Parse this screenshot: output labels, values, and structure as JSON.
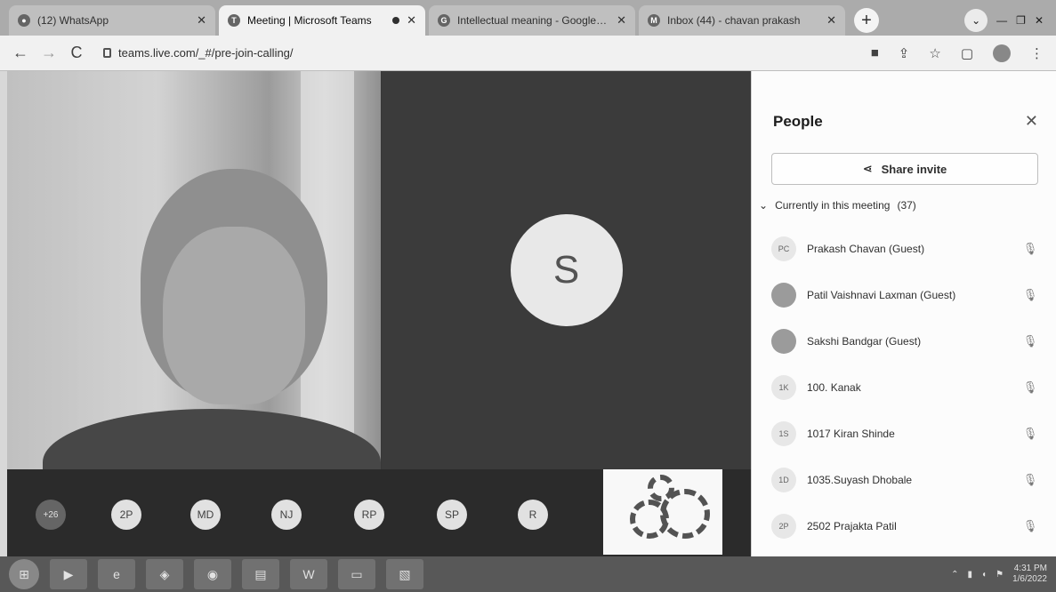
{
  "browser": {
    "tabs": [
      {
        "title": "(12) WhatsApp",
        "active": false,
        "icon": "whatsapp-icon"
      },
      {
        "title": "Meeting | Microsoft Teams",
        "active": true,
        "icon": "teams-icon"
      },
      {
        "title": "Intellectual meaning - Google Search",
        "active": false,
        "icon": "google-icon"
      },
      {
        "title": "Inbox (44) - chavan prakash",
        "active": false,
        "icon": "gmail-icon"
      }
    ],
    "new_tab": "+",
    "url": "teams.live.com/_#/pre-join-calling/"
  },
  "meeting": {
    "center_avatar": "S",
    "participants_strip": [
      {
        "initials": "+26",
        "more": true
      },
      {
        "initials": "2P"
      },
      {
        "initials": "MD"
      },
      {
        "initials": "NJ"
      },
      {
        "initials": "RP"
      },
      {
        "initials": "SP"
      },
      {
        "initials": "R"
      }
    ]
  },
  "people_panel": {
    "title": "People",
    "close_glyph": "✕",
    "share_invite": "Share invite",
    "section_label": "Currently in this meeting",
    "section_count": "(37)",
    "participants": [
      {
        "initials": "PC",
        "name": "Prakash Chavan (Guest)",
        "photo": false
      },
      {
        "initials": "",
        "name": "Patil Vaishnavi Laxman (Guest)",
        "photo": true
      },
      {
        "initials": "",
        "name": "Sakshi Bandgar (Guest)",
        "photo": true
      },
      {
        "initials": "1K",
        "name": "100. Kanak",
        "photo": false
      },
      {
        "initials": "1S",
        "name": "1017 Kiran Shinde",
        "photo": false
      },
      {
        "initials": "1D",
        "name": "1035.Suyash Dhobale",
        "photo": false
      },
      {
        "initials": "2P",
        "name": "2502 Prajakta Patil",
        "photo": false
      }
    ]
  },
  "taskbar": {
    "time": "4:31 PM",
    "date": "1/6/2022"
  }
}
